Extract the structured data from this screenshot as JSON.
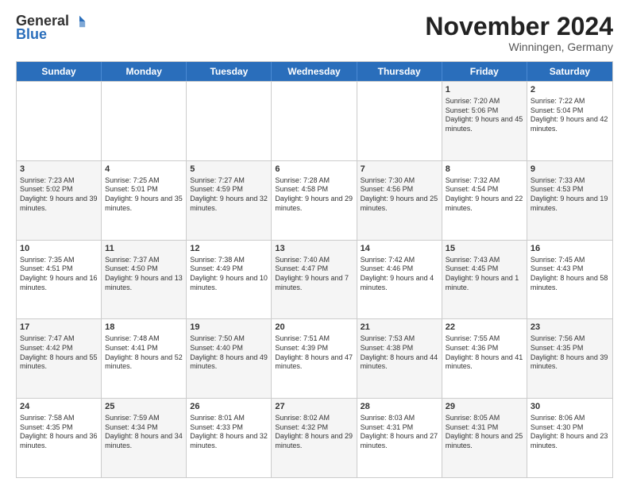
{
  "logo": {
    "general": "General",
    "blue": "Blue"
  },
  "title": "November 2024",
  "location": "Winningen, Germany",
  "header_days": [
    "Sunday",
    "Monday",
    "Tuesday",
    "Wednesday",
    "Thursday",
    "Friday",
    "Saturday"
  ],
  "rows": [
    [
      {
        "day": "",
        "info": "",
        "shaded": false
      },
      {
        "day": "",
        "info": "",
        "shaded": false
      },
      {
        "day": "",
        "info": "",
        "shaded": false
      },
      {
        "day": "",
        "info": "",
        "shaded": false
      },
      {
        "day": "",
        "info": "",
        "shaded": false
      },
      {
        "day": "1",
        "info": "Sunrise: 7:20 AM\nSunset: 5:06 PM\nDaylight: 9 hours and 45 minutes.",
        "shaded": true
      },
      {
        "day": "2",
        "info": "Sunrise: 7:22 AM\nSunset: 5:04 PM\nDaylight: 9 hours and 42 minutes.",
        "shaded": false
      }
    ],
    [
      {
        "day": "3",
        "info": "Sunrise: 7:23 AM\nSunset: 5:02 PM\nDaylight: 9 hours and 39 minutes.",
        "shaded": true
      },
      {
        "day": "4",
        "info": "Sunrise: 7:25 AM\nSunset: 5:01 PM\nDaylight: 9 hours and 35 minutes.",
        "shaded": false
      },
      {
        "day": "5",
        "info": "Sunrise: 7:27 AM\nSunset: 4:59 PM\nDaylight: 9 hours and 32 minutes.",
        "shaded": true
      },
      {
        "day": "6",
        "info": "Sunrise: 7:28 AM\nSunset: 4:58 PM\nDaylight: 9 hours and 29 minutes.",
        "shaded": false
      },
      {
        "day": "7",
        "info": "Sunrise: 7:30 AM\nSunset: 4:56 PM\nDaylight: 9 hours and 25 minutes.",
        "shaded": true
      },
      {
        "day": "8",
        "info": "Sunrise: 7:32 AM\nSunset: 4:54 PM\nDaylight: 9 hours and 22 minutes.",
        "shaded": false
      },
      {
        "day": "9",
        "info": "Sunrise: 7:33 AM\nSunset: 4:53 PM\nDaylight: 9 hours and 19 minutes.",
        "shaded": true
      }
    ],
    [
      {
        "day": "10",
        "info": "Sunrise: 7:35 AM\nSunset: 4:51 PM\nDaylight: 9 hours and 16 minutes.",
        "shaded": false
      },
      {
        "day": "11",
        "info": "Sunrise: 7:37 AM\nSunset: 4:50 PM\nDaylight: 9 hours and 13 minutes.",
        "shaded": true
      },
      {
        "day": "12",
        "info": "Sunrise: 7:38 AM\nSunset: 4:49 PM\nDaylight: 9 hours and 10 minutes.",
        "shaded": false
      },
      {
        "day": "13",
        "info": "Sunrise: 7:40 AM\nSunset: 4:47 PM\nDaylight: 9 hours and 7 minutes.",
        "shaded": true
      },
      {
        "day": "14",
        "info": "Sunrise: 7:42 AM\nSunset: 4:46 PM\nDaylight: 9 hours and 4 minutes.",
        "shaded": false
      },
      {
        "day": "15",
        "info": "Sunrise: 7:43 AM\nSunset: 4:45 PM\nDaylight: 9 hours and 1 minute.",
        "shaded": true
      },
      {
        "day": "16",
        "info": "Sunrise: 7:45 AM\nSunset: 4:43 PM\nDaylight: 8 hours and 58 minutes.",
        "shaded": false
      }
    ],
    [
      {
        "day": "17",
        "info": "Sunrise: 7:47 AM\nSunset: 4:42 PM\nDaylight: 8 hours and 55 minutes.",
        "shaded": true
      },
      {
        "day": "18",
        "info": "Sunrise: 7:48 AM\nSunset: 4:41 PM\nDaylight: 8 hours and 52 minutes.",
        "shaded": false
      },
      {
        "day": "19",
        "info": "Sunrise: 7:50 AM\nSunset: 4:40 PM\nDaylight: 8 hours and 49 minutes.",
        "shaded": true
      },
      {
        "day": "20",
        "info": "Sunrise: 7:51 AM\nSunset: 4:39 PM\nDaylight: 8 hours and 47 minutes.",
        "shaded": false
      },
      {
        "day": "21",
        "info": "Sunrise: 7:53 AM\nSunset: 4:38 PM\nDaylight: 8 hours and 44 minutes.",
        "shaded": true
      },
      {
        "day": "22",
        "info": "Sunrise: 7:55 AM\nSunset: 4:36 PM\nDaylight: 8 hours and 41 minutes.",
        "shaded": false
      },
      {
        "day": "23",
        "info": "Sunrise: 7:56 AM\nSunset: 4:35 PM\nDaylight: 8 hours and 39 minutes.",
        "shaded": true
      }
    ],
    [
      {
        "day": "24",
        "info": "Sunrise: 7:58 AM\nSunset: 4:35 PM\nDaylight: 8 hours and 36 minutes.",
        "shaded": false
      },
      {
        "day": "25",
        "info": "Sunrise: 7:59 AM\nSunset: 4:34 PM\nDaylight: 8 hours and 34 minutes.",
        "shaded": true
      },
      {
        "day": "26",
        "info": "Sunrise: 8:01 AM\nSunset: 4:33 PM\nDaylight: 8 hours and 32 minutes.",
        "shaded": false
      },
      {
        "day": "27",
        "info": "Sunrise: 8:02 AM\nSunset: 4:32 PM\nDaylight: 8 hours and 29 minutes.",
        "shaded": true
      },
      {
        "day": "28",
        "info": "Sunrise: 8:03 AM\nSunset: 4:31 PM\nDaylight: 8 hours and 27 minutes.",
        "shaded": false
      },
      {
        "day": "29",
        "info": "Sunrise: 8:05 AM\nSunset: 4:31 PM\nDaylight: 8 hours and 25 minutes.",
        "shaded": true
      },
      {
        "day": "30",
        "info": "Sunrise: 8:06 AM\nSunset: 4:30 PM\nDaylight: 8 hours and 23 minutes.",
        "shaded": false
      }
    ]
  ]
}
